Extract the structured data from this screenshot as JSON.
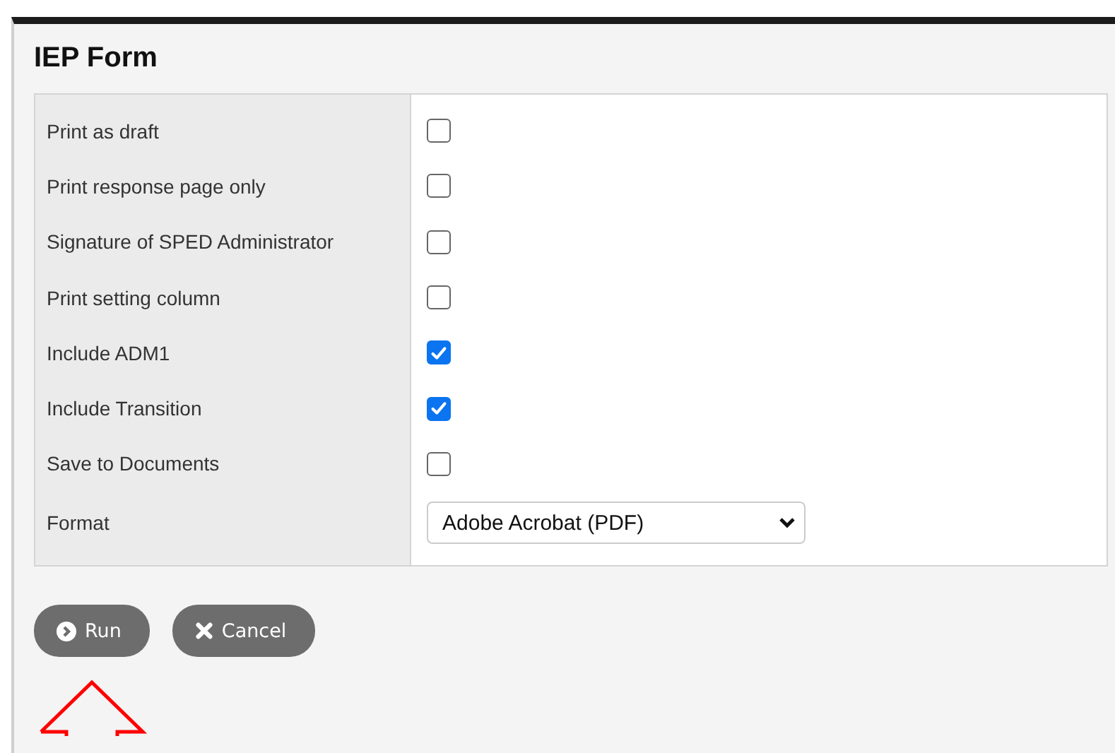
{
  "title": "IEP Form",
  "options": [
    {
      "kind": "checkbox",
      "label": "Print as draft",
      "checked": false
    },
    {
      "kind": "checkbox",
      "label": "Print response page only",
      "checked": false
    },
    {
      "kind": "checkbox",
      "label": "Signature of SPED Administrator",
      "checked": false
    },
    {
      "kind": "checkbox",
      "label": "Print setting column",
      "checked": false
    },
    {
      "kind": "checkbox",
      "label": "Include ADM1",
      "checked": true
    },
    {
      "kind": "checkbox",
      "label": "Include Transition",
      "checked": true
    },
    {
      "kind": "checkbox",
      "label": "Save to Documents",
      "checked": false
    },
    {
      "kind": "select",
      "label": "Format",
      "value": "Adobe Acrobat (PDF)"
    }
  ],
  "buttons": [
    {
      "kind": "run",
      "label": "Run"
    },
    {
      "kind": "cancel",
      "label": "Cancel"
    }
  ]
}
